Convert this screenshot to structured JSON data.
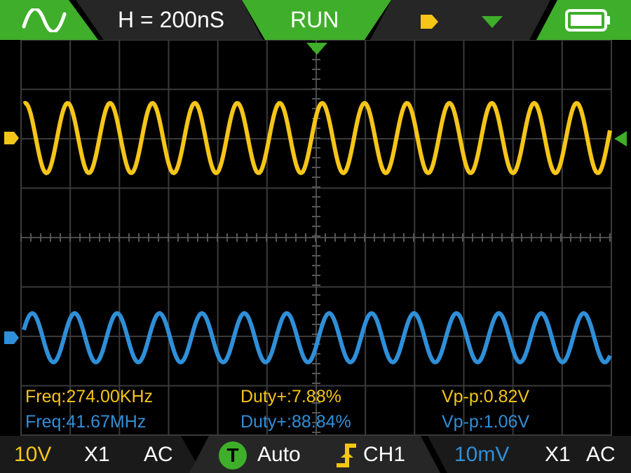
{
  "topbar": {
    "wave_icon": "sine-wave-icon",
    "timebase": "H = 200nS",
    "run_state": "RUN",
    "ch1_marker_icon": "yellow-channel-marker-icon",
    "trigger_marker_icon": "green-trigger-marker-icon",
    "battery_icon": "battery-icon",
    "battery_level": 1.0
  },
  "colors": {
    "ch1": "#f5c518",
    "ch2": "#2f8fd8",
    "trigger": "#3fae2a",
    "grid": "#3a3a3a",
    "bar": "#1a1a1a"
  },
  "measurements": {
    "ch1": {
      "freq": "Freq:274.00KHz",
      "duty": "Duty+:7.88%",
      "vpp": "Vp-p:0.82V"
    },
    "ch2": {
      "freq": "Freq:41.67MHz",
      "duty": "Duty+:88.84%",
      "vpp": "Vp-p:1.06V"
    }
  },
  "bottombar": {
    "ch1": {
      "volts_div": "10V",
      "probe": "X1",
      "coupling": "AC"
    },
    "trigger": {
      "badge": "T",
      "mode": "Auto",
      "edge_icon": "rising-edge-icon",
      "source": "CH1"
    },
    "ch2": {
      "volts_div": "10mV",
      "probe": "X1",
      "coupling": "AC"
    }
  }
}
